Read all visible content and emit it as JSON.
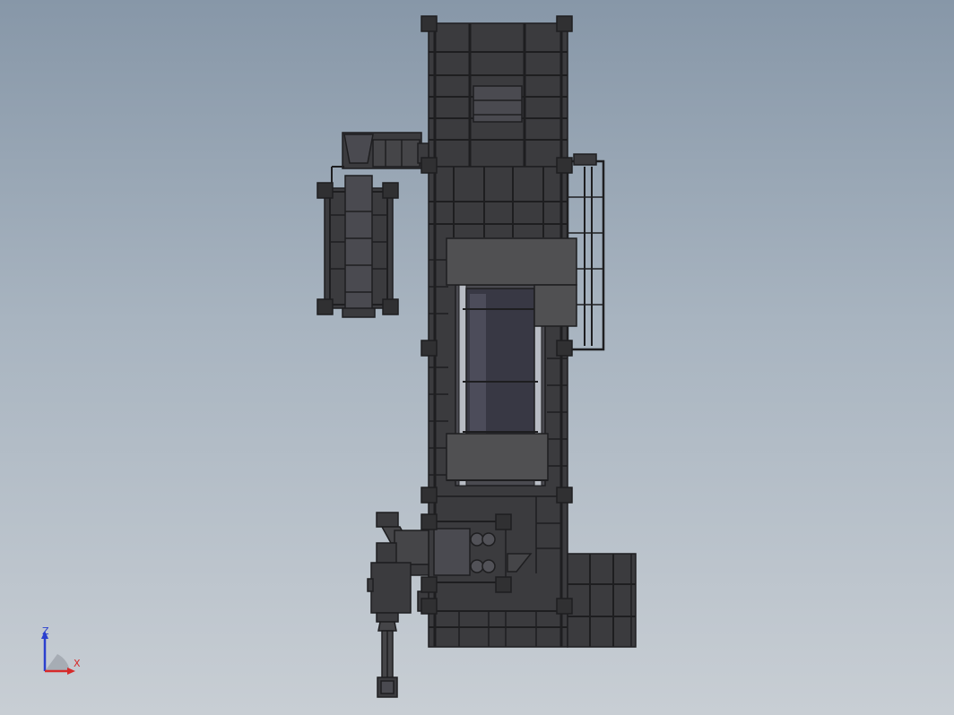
{
  "view": {
    "background_top": "#8797a8",
    "background_bottom": "#c8ced4",
    "model_color": "#3f3f42",
    "edge_color": "#1e1e20"
  },
  "triad": {
    "z_label": "Z",
    "x_label": "X",
    "z_color": "#2a3fcf",
    "x_color": "#d62a2a"
  }
}
